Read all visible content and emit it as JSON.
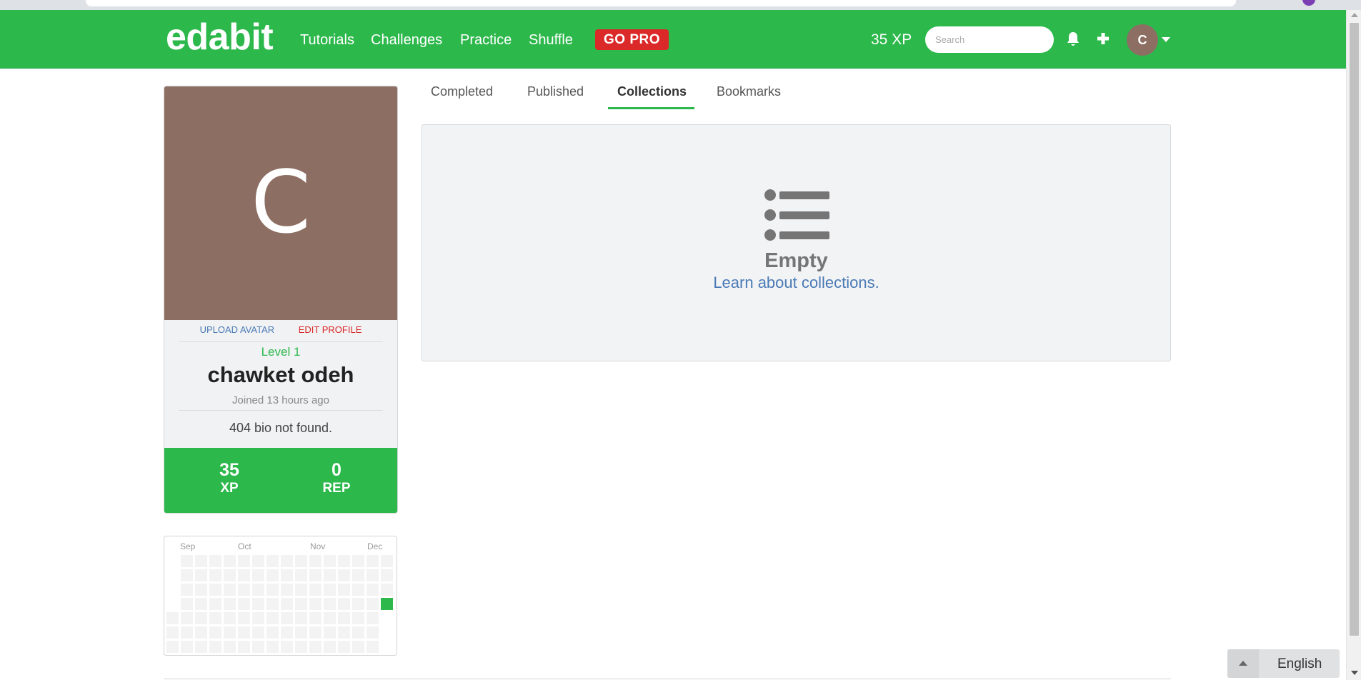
{
  "navbar": {
    "logo": "edabit",
    "links": [
      "Tutorials",
      "Challenges",
      "Practice",
      "Shuffle"
    ],
    "go_pro": "GO PRO",
    "xp": "35 XP",
    "search_placeholder": "Search",
    "avatar_initial": "C",
    "brand_color": "#2db84c"
  },
  "profile": {
    "avatar_letter": "C",
    "upload_avatar": "UPLOAD AVATAR",
    "edit_profile": "EDIT PROFILE",
    "level": "Level 1",
    "name": "chawket odeh",
    "joined": "Joined 13 hours ago",
    "bio": "404 bio not found.",
    "stats": {
      "xp_value": "35",
      "xp_label": "XP",
      "rep_value": "0",
      "rep_label": "REP"
    }
  },
  "activity": {
    "months": [
      "Sep",
      "Oct",
      "Nov",
      "Dec"
    ],
    "active_color": "#2db84c"
  },
  "tabs": {
    "items": [
      "Completed",
      "Published",
      "Collections",
      "Bookmarks"
    ],
    "active": "Collections"
  },
  "collections": {
    "empty_title": "Empty",
    "learn_link": "Learn about collections."
  },
  "language": {
    "selected": "English"
  }
}
